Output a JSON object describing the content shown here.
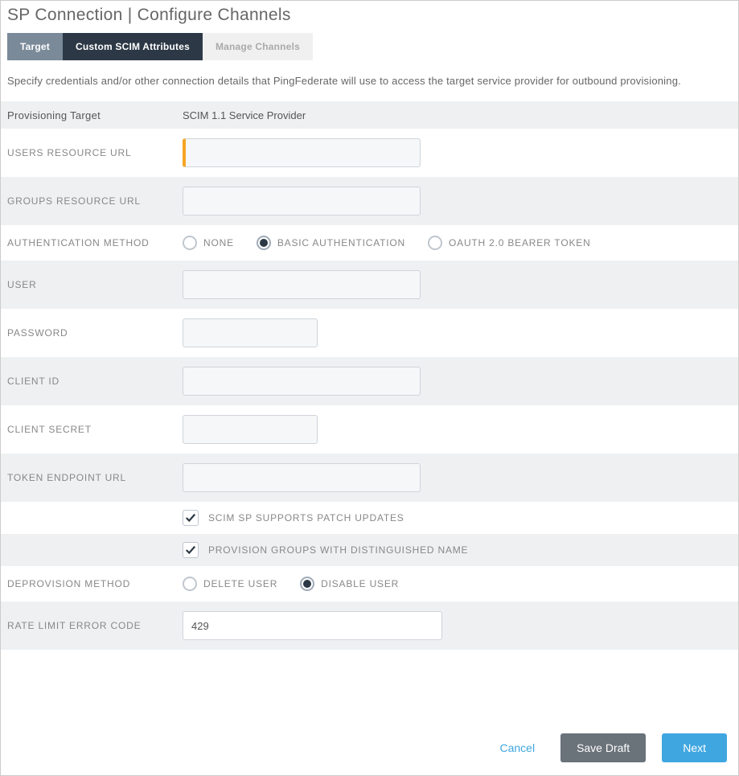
{
  "header": {
    "title": "SP Connection | Configure Channels"
  },
  "tabs": [
    {
      "label": "Target",
      "state": "active"
    },
    {
      "label": "Custom SCIM Attributes",
      "state": "dark"
    },
    {
      "label": "Manage Channels",
      "state": "inactive"
    }
  ],
  "description": "Specify credentials and/or other connection details that PingFederate will use to access the target service provider for outbound provisioning.",
  "fields": {
    "provisioning_target": {
      "label": "Provisioning Target",
      "value": "SCIM 1.1 Service Provider"
    },
    "users_resource_url": {
      "label": "USERS RESOURCE URL",
      "value": ""
    },
    "groups_resource_url": {
      "label": "GROUPS RESOURCE URL",
      "value": ""
    },
    "auth_method": {
      "label": "AUTHENTICATION METHOD",
      "options": [
        {
          "label": "NONE",
          "checked": false
        },
        {
          "label": "BASIC AUTHENTICATION",
          "checked": true
        },
        {
          "label": "OAUTH 2.0 BEARER TOKEN",
          "checked": false
        }
      ]
    },
    "user": {
      "label": "USER",
      "value": ""
    },
    "password": {
      "label": "PASSWORD",
      "value": ""
    },
    "client_id": {
      "label": "CLIENT ID",
      "value": ""
    },
    "client_secret": {
      "label": "CLIENT SECRET",
      "value": ""
    },
    "token_endpoint_url": {
      "label": "TOKEN ENDPOINT URL",
      "value": ""
    },
    "patch_updates": {
      "label": "SCIM SP SUPPORTS PATCH UPDATES",
      "checked": true
    },
    "provision_groups_dn": {
      "label": "PROVISION GROUPS WITH DISTINGUISHED NAME",
      "checked": true
    },
    "deprovision_method": {
      "label": "DEPROVISION METHOD",
      "options": [
        {
          "label": "DELETE USER",
          "checked": false
        },
        {
          "label": "DISABLE USER",
          "checked": true
        }
      ]
    },
    "rate_limit_error_code": {
      "label": "RATE LIMIT ERROR CODE",
      "value": "429"
    }
  },
  "footer": {
    "cancel": "Cancel",
    "save_draft": "Save Draft",
    "next": "Next"
  }
}
